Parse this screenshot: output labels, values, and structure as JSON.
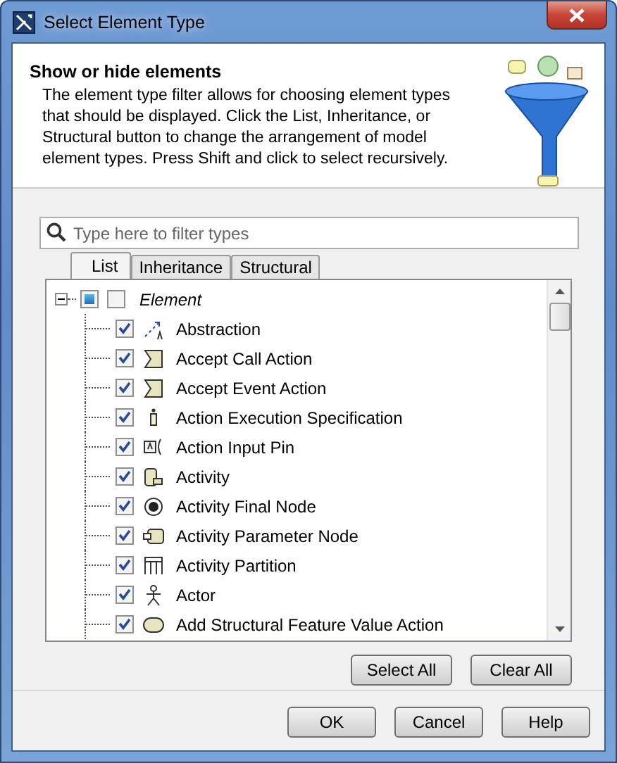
{
  "window": {
    "title": "Select Element Type"
  },
  "header": {
    "title": "Show or hide elements",
    "description": "The element type filter allows for choosing element types that should be displayed. Click the List, Inheritance, or Structural button to change the arrangement of model element types. Press Shift and click to select recursively."
  },
  "search": {
    "placeholder": "Type here to filter types"
  },
  "tabs": [
    {
      "label": "List",
      "selected": true
    },
    {
      "label": "Inheritance",
      "selected": false
    },
    {
      "label": "Structural",
      "selected": false
    }
  ],
  "tree": {
    "label": "Element",
    "expanded": true,
    "partial": true,
    "checked": false,
    "children": [
      {
        "label": "Abstraction",
        "checked": true
      },
      {
        "label": "Accept Call Action",
        "checked": true
      },
      {
        "label": "Accept Event Action",
        "checked": true
      },
      {
        "label": "Action Execution Specification",
        "checked": true
      },
      {
        "label": "Action Input Pin",
        "checked": true
      },
      {
        "label": "Activity",
        "checked": true
      },
      {
        "label": "Activity Final Node",
        "checked": true
      },
      {
        "label": "Activity Parameter Node",
        "checked": true
      },
      {
        "label": "Activity Partition",
        "checked": true
      },
      {
        "label": "Actor",
        "checked": true
      },
      {
        "label": "Add Structural Feature Value Action",
        "checked": true
      }
    ]
  },
  "list_buttons": [
    "Select All",
    "Clear All"
  ],
  "buttons": [
    "OK",
    "Cancel",
    "Help"
  ]
}
